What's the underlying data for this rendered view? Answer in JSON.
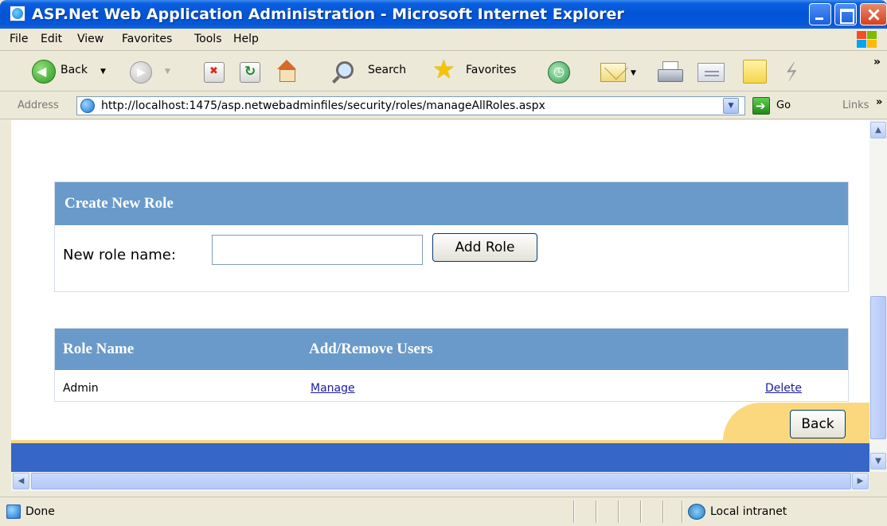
{
  "window": {
    "title": "ASP.Net Web Application Administration - Microsoft Internet Explorer"
  },
  "menu": {
    "file": "File",
    "edit": "Edit",
    "view": "View",
    "favorites": "Favorites",
    "tools": "Tools",
    "help": "Help"
  },
  "toolbar": {
    "back_label": "Back",
    "search_label": "Search",
    "favorites_label": "Favorites",
    "chevron": "»"
  },
  "address": {
    "label": "Address",
    "url": "http://localhost:1475/asp.netwebadminfiles/security/roles/manageAllRoles.aspx",
    "go_label": "Go",
    "links_label": "Links",
    "links_chevron": "»"
  },
  "create_role": {
    "header": "Create New Role",
    "field_label": "New role name:",
    "field_value": "",
    "button_label": "Add Role"
  },
  "roles_table": {
    "columns": [
      "Role Name",
      "Add/Remove Users"
    ],
    "rows": [
      {
        "name": "Admin",
        "manage_link": "Manage",
        "delete_link": "Delete"
      }
    ]
  },
  "page": {
    "back_button": "Back"
  },
  "status": {
    "text": "Done",
    "zone": "Local intranet"
  },
  "colors": {
    "panel_header": "#6a9ac9",
    "footer_band": "#3566c8",
    "footer_gold": "#fbd87e",
    "link": "#1a1aa6"
  },
  "icons": {
    "back": "back-arrow-icon",
    "forward": "forward-arrow-icon",
    "stop": "stop-icon",
    "refresh": "refresh-icon",
    "home": "home-icon",
    "search": "search-icon",
    "favorites": "star-icon",
    "history": "history-icon",
    "mail": "mail-icon",
    "print": "print-icon",
    "edit": "edit-icon",
    "note": "note-icon",
    "messenger": "messenger-icon",
    "go": "go-arrow-icon",
    "page": "ie-page-icon",
    "intranet": "local-intranet-icon"
  }
}
